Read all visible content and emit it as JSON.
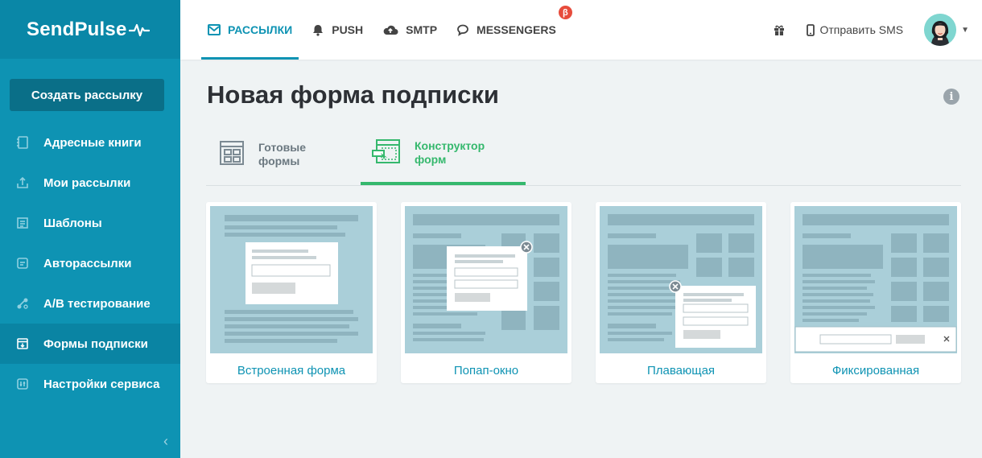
{
  "brand": {
    "name": "SendPulse"
  },
  "sidebar": {
    "create_button": "Создать рассылку",
    "items": [
      {
        "label": "Адресные книги",
        "icon": "address-book-icon"
      },
      {
        "label": "Мои рассылки",
        "icon": "mailings-icon"
      },
      {
        "label": "Шаблоны",
        "icon": "templates-icon"
      },
      {
        "label": "Авторассылки",
        "icon": "automation-icon"
      },
      {
        "label": "А/В тестирование",
        "icon": "ab-test-icon"
      },
      {
        "label": "Формы подписки",
        "icon": "subscription-forms-icon",
        "active": true
      },
      {
        "label": "Настройки сервиса",
        "icon": "settings-icon"
      }
    ],
    "collapse_icon": "chevron-left-icon"
  },
  "topbar": {
    "nav": [
      {
        "label": "РАССЫЛКИ",
        "icon": "envelope-icon",
        "active": true
      },
      {
        "label": "PUSH",
        "icon": "bell-icon"
      },
      {
        "label": "SMTP",
        "icon": "cloud-upload-icon"
      },
      {
        "label": "MESSENGERS",
        "icon": "chat-bubble-icon",
        "badge": "β"
      }
    ],
    "send_sms": "Отправить SMS",
    "gift_icon": "gift-icon"
  },
  "page": {
    "title": "Новая форма подписки",
    "tabs": [
      {
        "label": "Готовые\nформы",
        "icon": "ready-forms-icon"
      },
      {
        "label": "Конструктор\nформ",
        "icon": "form-builder-icon",
        "active": true
      }
    ],
    "cards": [
      {
        "label": "Встроенная форма"
      },
      {
        "label": "Попап-окно"
      },
      {
        "label": "Плавающая"
      },
      {
        "label": "Фиксированная"
      }
    ]
  },
  "colors": {
    "sidebar": "#0e93b3",
    "accent_green": "#35b86d",
    "link": "#0e93b3",
    "background": "#eff3f4"
  }
}
